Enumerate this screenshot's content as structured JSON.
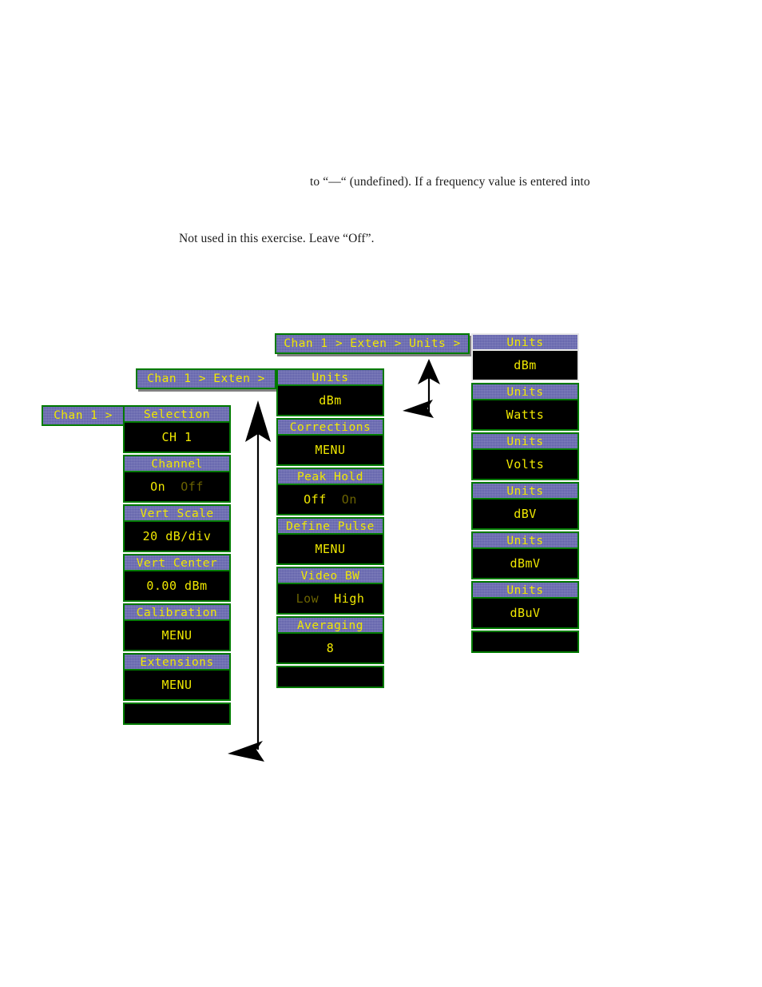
{
  "document": {
    "line1": "to “—“ (undefined). If a frequency value is entered into",
    "line2": "Not used in this exercise. Leave “Off”."
  },
  "colors": {
    "panel_border": "#007a00",
    "selected_border": "#e8e8e8",
    "title_bar": "#5c5ca8",
    "text_yellow": "#f0e800",
    "text_dim": "#6b6300",
    "background": "#000000"
  },
  "breadcrumbs": {
    "chan1": "Chan 1 >",
    "chan1_exten": "Chan 1 > Exten >",
    "chan1_exten_units": "Chan 1 > Exten > Units >"
  },
  "channel_menu": {
    "title": "Chan 1 >",
    "softkeys": [
      {
        "title": "Selection",
        "value": "CH 1",
        "kind": "value"
      },
      {
        "title": "Channel",
        "value": "On  Off",
        "kind": "toggle",
        "options": [
          "On",
          "Off"
        ],
        "selected": "On"
      },
      {
        "title": "Vert Scale",
        "value": "20 dB/div",
        "kind": "value"
      },
      {
        "title": "Vert Center",
        "value": "0.00 dBm",
        "kind": "value"
      },
      {
        "title": "Calibration",
        "value": "MENU",
        "kind": "menu"
      },
      {
        "title": "Extensions",
        "value": "MENU",
        "kind": "menu"
      }
    ]
  },
  "extensions_menu": {
    "title": "Chan 1 > Exten >",
    "softkeys": [
      {
        "title": "Units",
        "value": "dBm",
        "kind": "value"
      },
      {
        "title": "Corrections",
        "value": "MENU",
        "kind": "menu"
      },
      {
        "title": "Peak Hold",
        "value": "Off  On",
        "kind": "toggle",
        "options": [
          "Off",
          "On"
        ],
        "selected": "Off"
      },
      {
        "title": "Define Pulse",
        "value": "MENU",
        "kind": "menu"
      },
      {
        "title": "Video BW",
        "value": "Low High",
        "kind": "toggle",
        "options": [
          "Low",
          "High"
        ],
        "selected": "High"
      },
      {
        "title": "Averaging",
        "value": "8",
        "kind": "value"
      }
    ]
  },
  "units_menu": {
    "title": "Chan 1 > Exten > Units >",
    "softkeys": [
      {
        "title": "Units",
        "value": "dBm",
        "selected": true
      },
      {
        "title": "Units",
        "value": "Watts",
        "selected": false
      },
      {
        "title": "Units",
        "value": "Volts",
        "selected": false
      },
      {
        "title": "Units",
        "value": "dBV",
        "selected": false
      },
      {
        "title": "Units",
        "value": "dBmV",
        "selected": false
      },
      {
        "title": "Units",
        "value": "dBuV",
        "selected": false
      }
    ]
  },
  "arrows": {
    "extensions_to_exten_menu": "elbow-arrow-up-left",
    "units_to_units_menu": "elbow-arrow-up-left"
  }
}
